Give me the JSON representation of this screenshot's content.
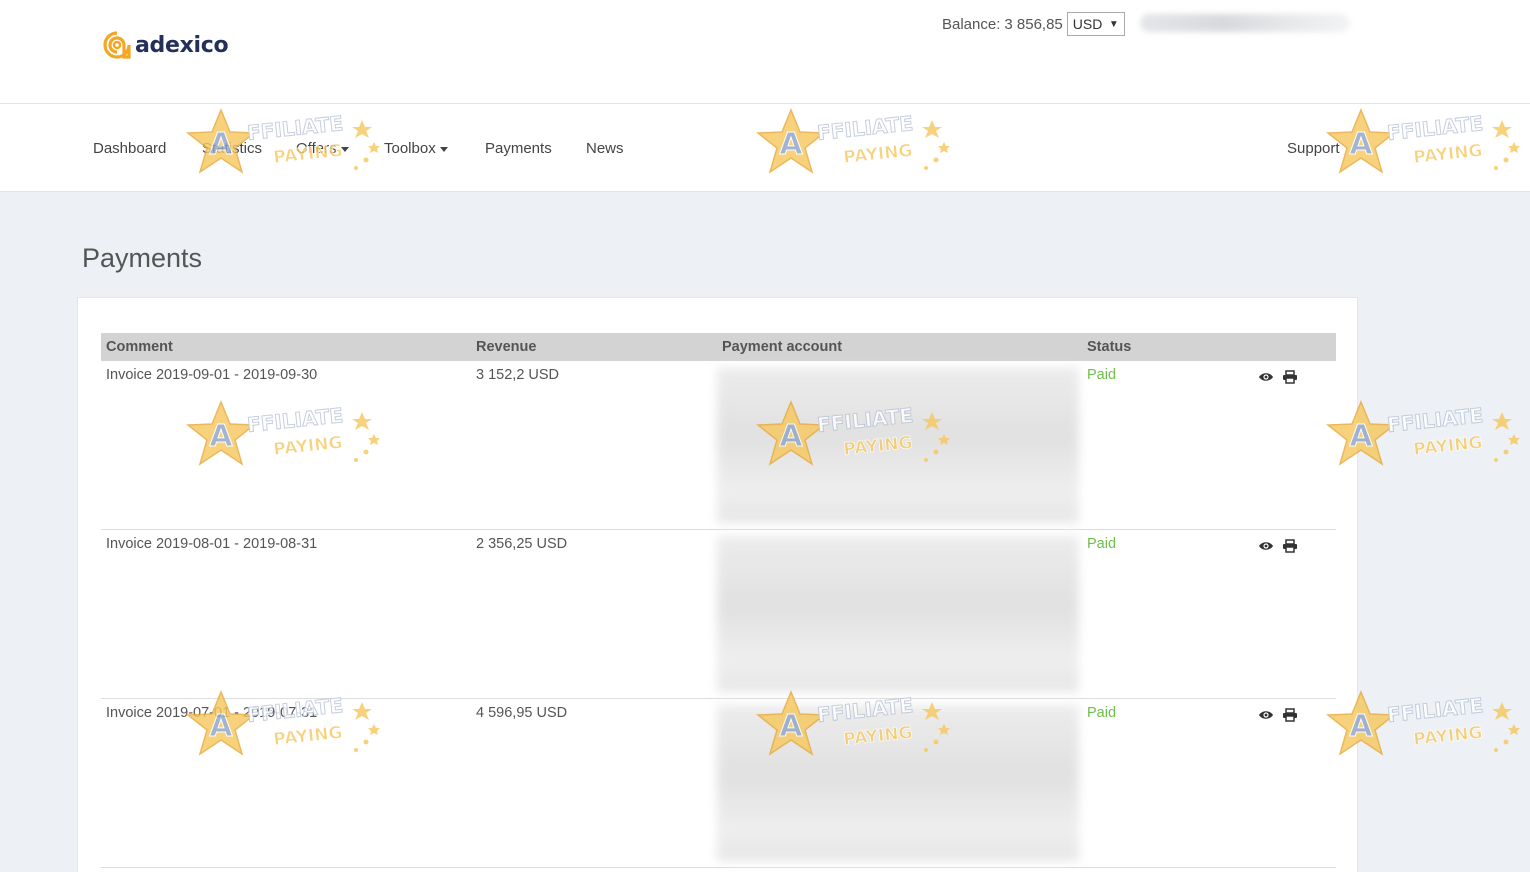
{
  "header": {
    "logo_text": "adexico",
    "balance_label": "Balance:",
    "balance_value": "3 856,85",
    "currency": "USD"
  },
  "nav": {
    "items": [
      "Dashboard",
      "Statistics",
      "Offers",
      "Toolbox",
      "Payments",
      "News"
    ],
    "support": "Support"
  },
  "page": {
    "title": "Payments"
  },
  "table": {
    "columns": [
      "Comment",
      "Revenue",
      "Payment account",
      "Status"
    ],
    "rows": [
      {
        "comment": "Invoice 2019-09-01 - 2019-09-30",
        "revenue": "3 152,2 USD",
        "status": "Paid"
      },
      {
        "comment": "Invoice 2019-08-01 - 2019-08-31",
        "revenue": "2 356,25 USD",
        "status": "Paid"
      },
      {
        "comment": "Invoice 2019-07-01 - 2019-07-31",
        "revenue": "4 596,95 USD",
        "status": "Paid"
      }
    ]
  },
  "watermark": {
    "line1": "AFFILIATE",
    "line2": "PAYING"
  },
  "colors": {
    "brand_navy": "#23305a",
    "brand_orange": "#f5a623",
    "paid_green": "#6fbf4a",
    "header_gray": "#d3d3d3",
    "page_bg": "#edf0f4"
  },
  "icons": [
    "view-eye-icon",
    "print-icon",
    "caret-down-icon"
  ]
}
